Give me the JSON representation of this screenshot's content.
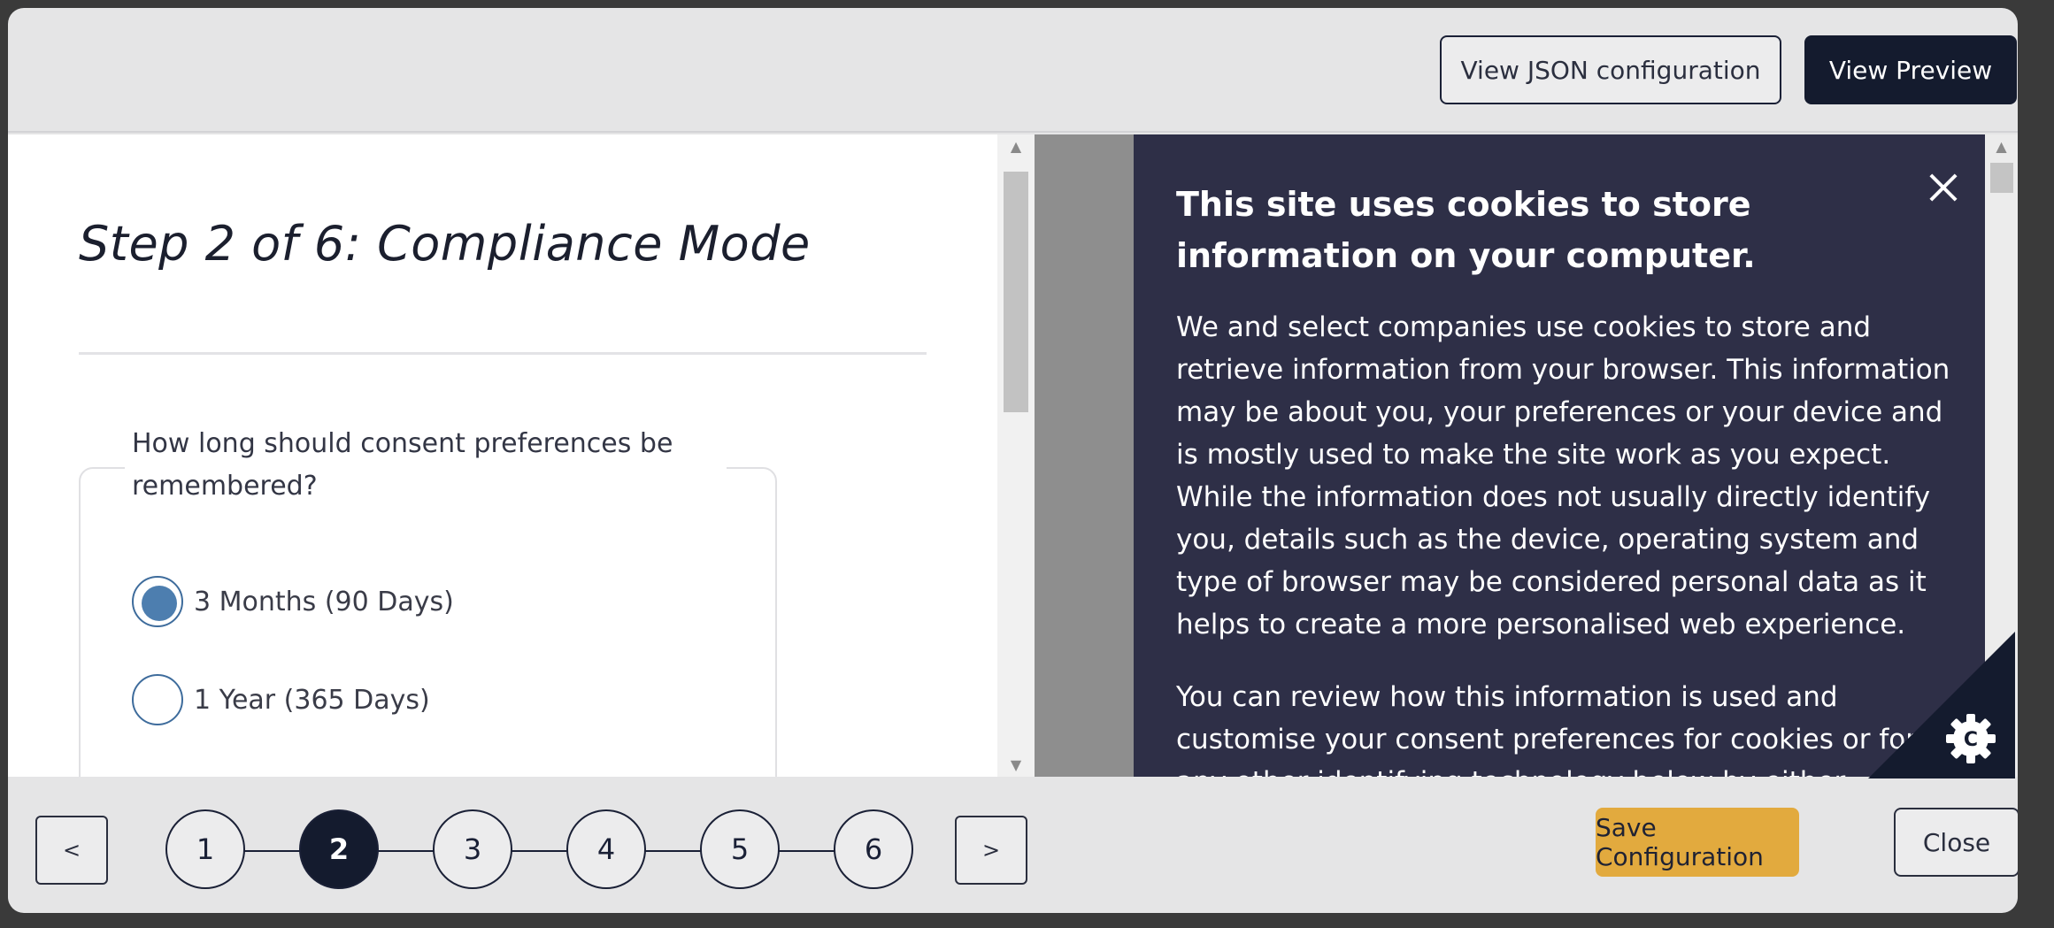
{
  "header": {
    "json_button": "View JSON configuration",
    "preview_button": "View Preview"
  },
  "form": {
    "step_title": "Step 2 of 6: Compliance Mode",
    "question": "How long should consent preferences be remembered?",
    "options": [
      {
        "label": "3 Months (90 Days)",
        "checked": true
      },
      {
        "label": "1 Year (365 Days)",
        "checked": false
      }
    ]
  },
  "banner": {
    "title": "This site uses cookies to store information on your computer.",
    "paragraph1": "We and select companies use cookies to store and retrieve information from your browser. This information may be about you, your preferences or your device and is mostly used to make the site work as you expect. While the information does not usually directly identify you, details such as the device, operating system and type of browser may be considered personal data as it helps to create a more personalised web experience.",
    "paragraph2": "You can review how this information is used and customise your consent preferences for cookies or for any other identifying technology below by either purpose, feature",
    "badge_letter": "C",
    "badge_icon": "cookie-gear-icon"
  },
  "footer": {
    "prev": "<",
    "next": ">",
    "steps": [
      "1",
      "2",
      "3",
      "4",
      "5",
      "6"
    ],
    "active_step": "2",
    "save_button": "Save Configuration",
    "close_button": "Close"
  },
  "colors": {
    "dark_navy": "#141b2e",
    "banner_bg": "#2e2f47",
    "save_accent": "#e2aa3e",
    "radio_blue": "#4d7eaf"
  }
}
